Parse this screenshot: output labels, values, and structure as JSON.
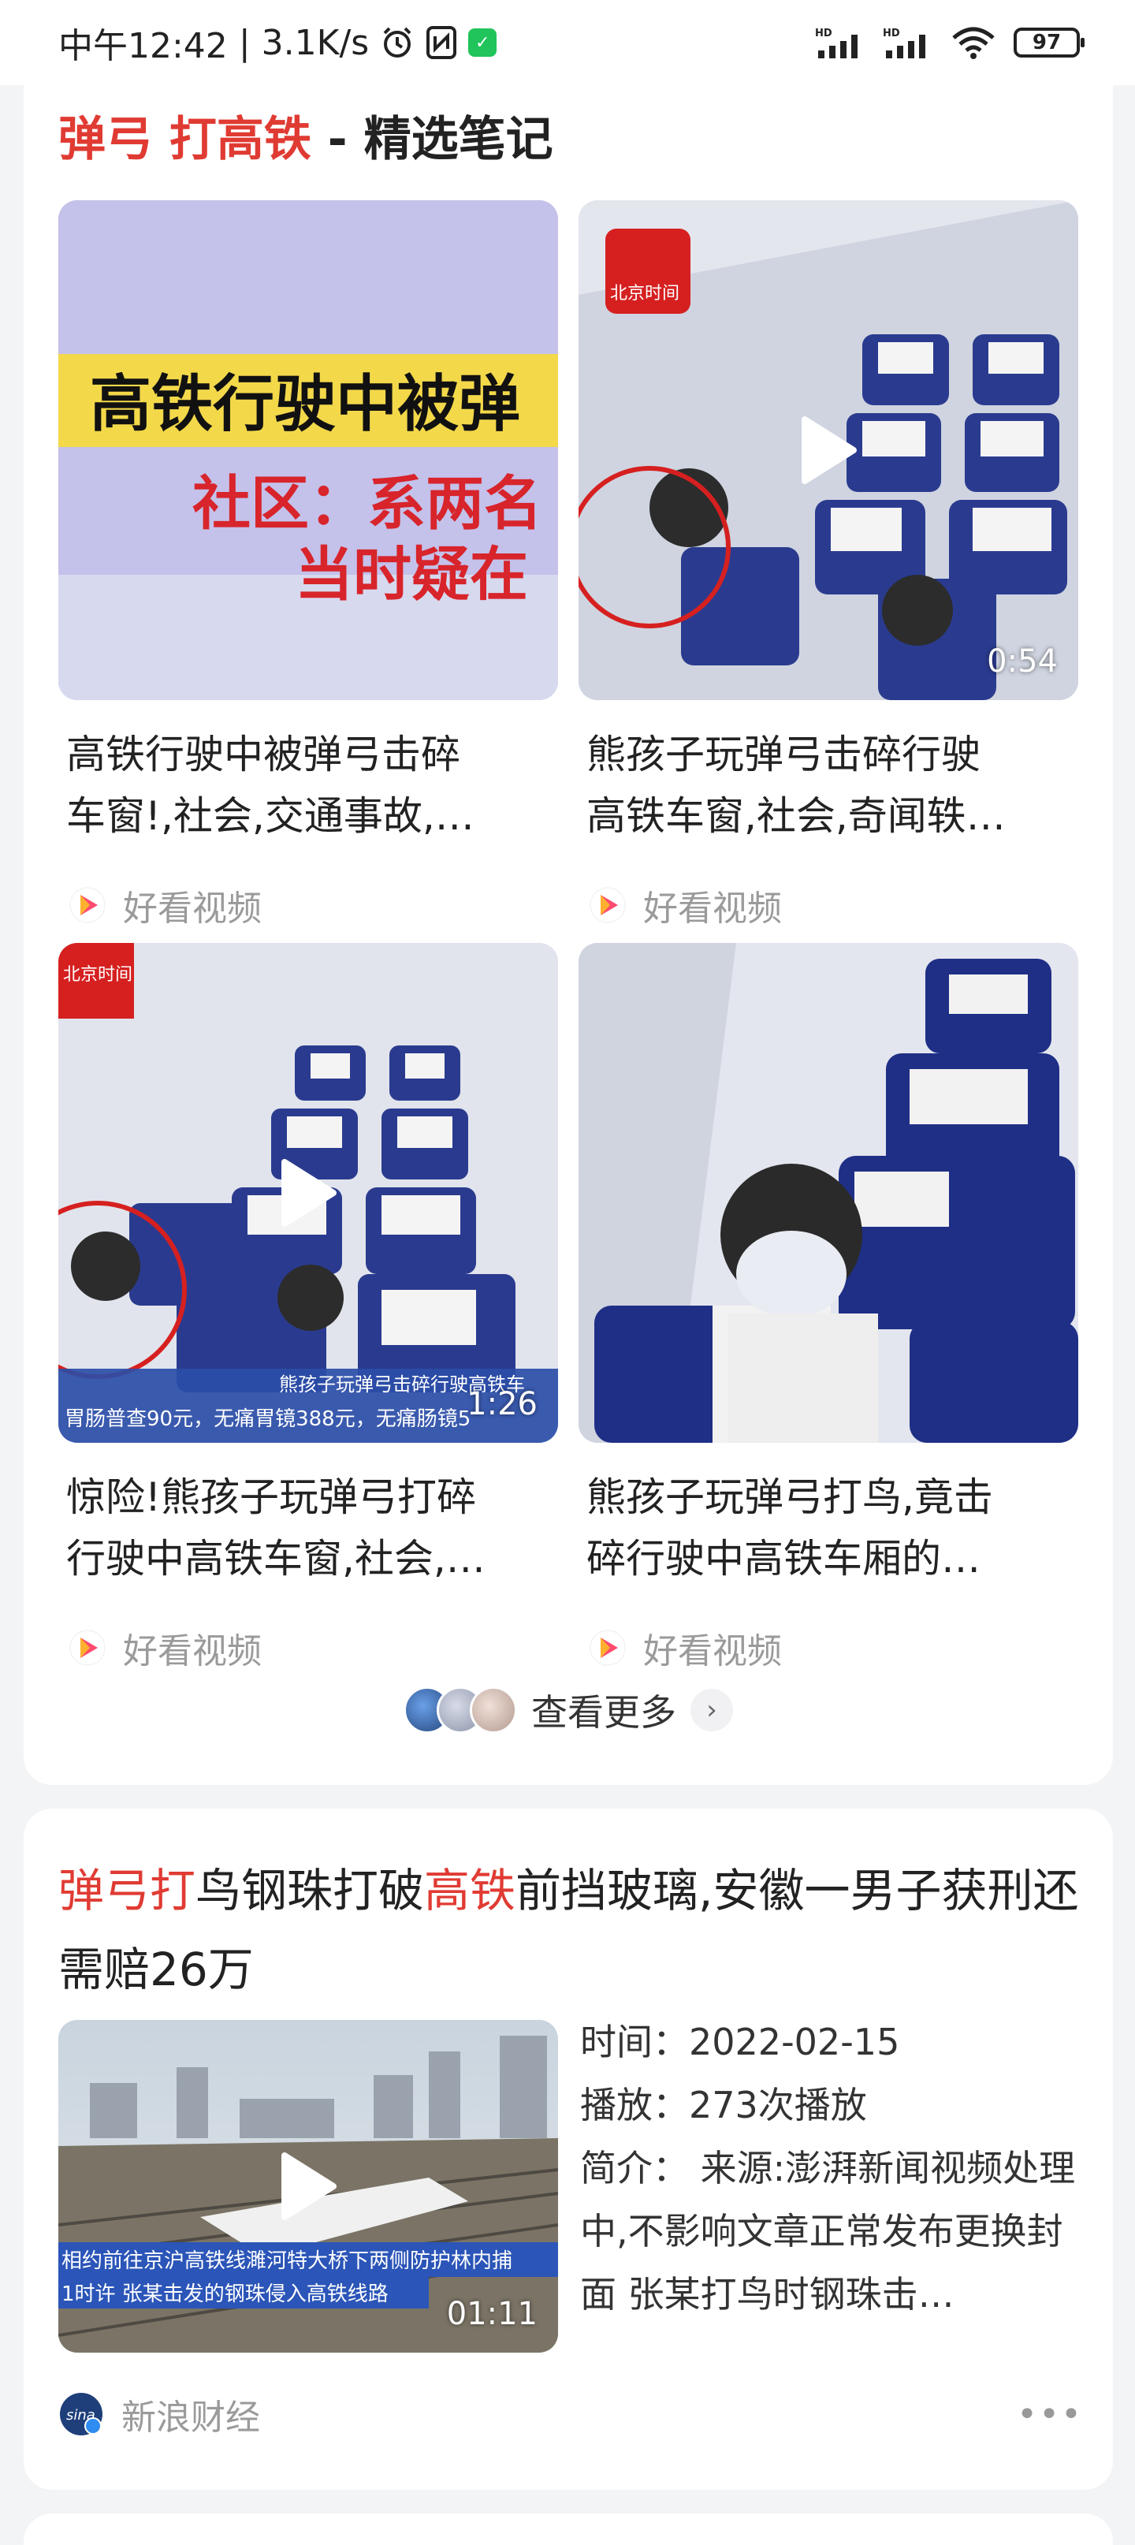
{
  "status_bar": {
    "time": "中午12:42",
    "speed": "3.1K/s",
    "battery": "97",
    "net1": "HD",
    "net2": "HD"
  },
  "section": {
    "title_part1": "弹弓",
    "title_part2": "打高铁",
    "title_suffix": " - 精选笔记",
    "more_label": "查看更多"
  },
  "tiles": [
    {
      "line1": "高铁行驶中被弹弓击碎",
      "line2": "车窗!,社会,交通事故,…",
      "source": "好看视频",
      "thumb_text1": "高铁行驶中被弹",
      "thumb_text2": "社区：系两名",
      "thumb_text3": "当时疑在"
    },
    {
      "line1": "熊孩子玩弹弓击碎行驶",
      "line2": "高铁车窗,社会,奇闻轶…",
      "source": "好看视频",
      "duration": "0:54",
      "badge": "北京时间"
    },
    {
      "line1": "惊险!熊孩子玩弹弓打碎",
      "line2": "行驶中高铁车窗,社会,…",
      "source": "好看视频",
      "duration": "1:26",
      "badge": "北京时间",
      "ticker1": "熊孩子玩弹弓击碎行驶高铁车",
      "ticker2": "胃肠普查90元，无痛胃镜388元，无痛肠镜5"
    },
    {
      "line1": "熊孩子玩弹弓打鸟,竟击",
      "line2": "碎行驶中高铁车厢的…",
      "source": "好看视频"
    }
  ],
  "article": {
    "title_parts": [
      "弹弓打",
      "鸟钢珠打破",
      "高铁",
      "前挡玻璃,安徽一男子获刑还需赔26万"
    ],
    "time_label": "时间：",
    "time_value": "2022-02-15",
    "plays_label": "播放：",
    "plays_value": "273次播放",
    "intro_label": "简介：",
    "intro_value": " 来源:澎湃新闻视频处理中,不影响文章正常发布更换封面 张某打鸟时钢珠击…",
    "duration": "01:11",
    "ticker1": "相约前往京沪高铁线濉河特大桥下两侧防护林内捕",
    "ticker2": "1时许 张某击发的钢珠侵入高铁线路",
    "source": "新浪财经",
    "more": "•••"
  }
}
